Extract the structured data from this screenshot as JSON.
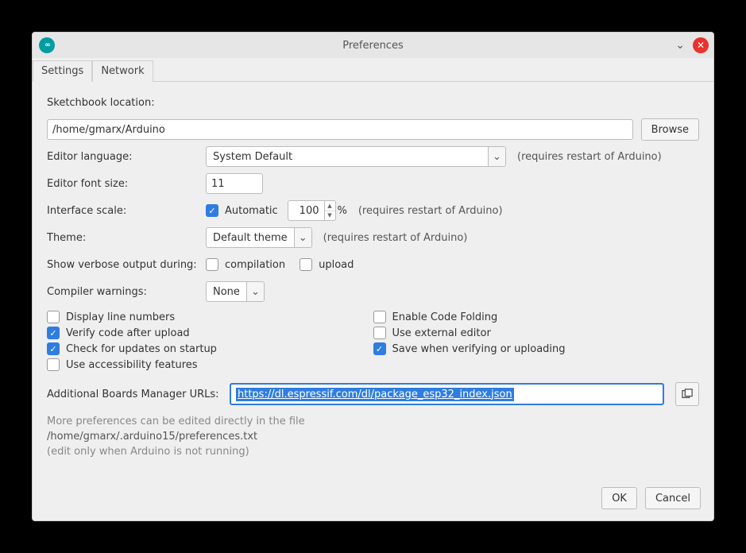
{
  "title": "Preferences",
  "tabs": {
    "settings": "Settings",
    "network": "Network"
  },
  "sketchbook": {
    "label": "Sketchbook location:",
    "path": "/home/gmarx/Arduino",
    "browse": "Browse"
  },
  "editorLanguage": {
    "label": "Editor language:",
    "value": "System Default",
    "note": "(requires restart of Arduino)"
  },
  "fontSize": {
    "label": "Editor font size:",
    "value": "11"
  },
  "scale": {
    "label": "Interface scale:",
    "autoLabel": "Automatic",
    "value": "100",
    "pct": "%",
    "note": "(requires restart of Arduino)"
  },
  "theme": {
    "label": "Theme:",
    "value": "Default theme",
    "note": "(requires restart of Arduino)"
  },
  "verbose": {
    "label": "Show verbose output during:",
    "compilation": "compilation",
    "upload": "upload"
  },
  "compiler": {
    "label": "Compiler warnings:",
    "value": "None"
  },
  "checks": {
    "lineNumbers": "Display line numbers",
    "codeFolding": "Enable Code Folding",
    "verify": "Verify code after upload",
    "external": "Use external editor",
    "updates": "Check for updates on startup",
    "saveVerify": "Save when verifying or uploading",
    "accessibility": "Use accessibility features"
  },
  "boards": {
    "label": "Additional Boards Manager URLs:",
    "value": "https://dl.espressif.com/dl/package_esp32_index.json"
  },
  "footnote": {
    "l1": "More preferences can be edited directly in the file",
    "path": "/home/gmarx/.arduino15/preferences.txt",
    "l2": "(edit only when Arduino is not running)"
  },
  "buttons": {
    "ok": "OK",
    "cancel": "Cancel"
  }
}
